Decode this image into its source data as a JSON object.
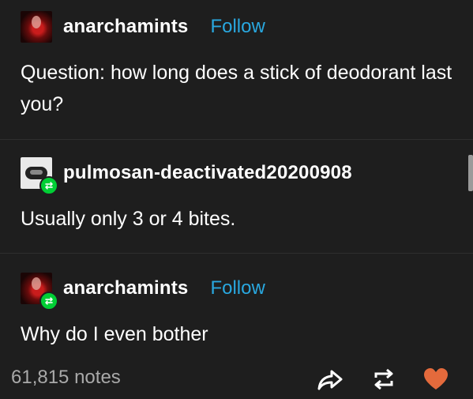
{
  "posts": [
    {
      "username": "anarchamints",
      "follow_label": "Follow",
      "body": "Question: how long does a stick of deodorant last you?"
    },
    {
      "username": "pulmosan-deactivated20200908",
      "body": "Usually only 3 or 4 bites."
    },
    {
      "username": "anarchamints",
      "follow_label": "Follow",
      "body": "Why do I even bother"
    }
  ],
  "footer": {
    "notes": "61,815 notes"
  },
  "colors": {
    "background": "#1e1e1e",
    "follow": "#29a8e0",
    "reblog_badge": "#00cf35",
    "like": "#e46a3c",
    "notes_text": "#a9a9a9"
  },
  "icons": [
    "share-icon",
    "reblog-icon",
    "heart-icon",
    "reblog-badge-icon"
  ]
}
